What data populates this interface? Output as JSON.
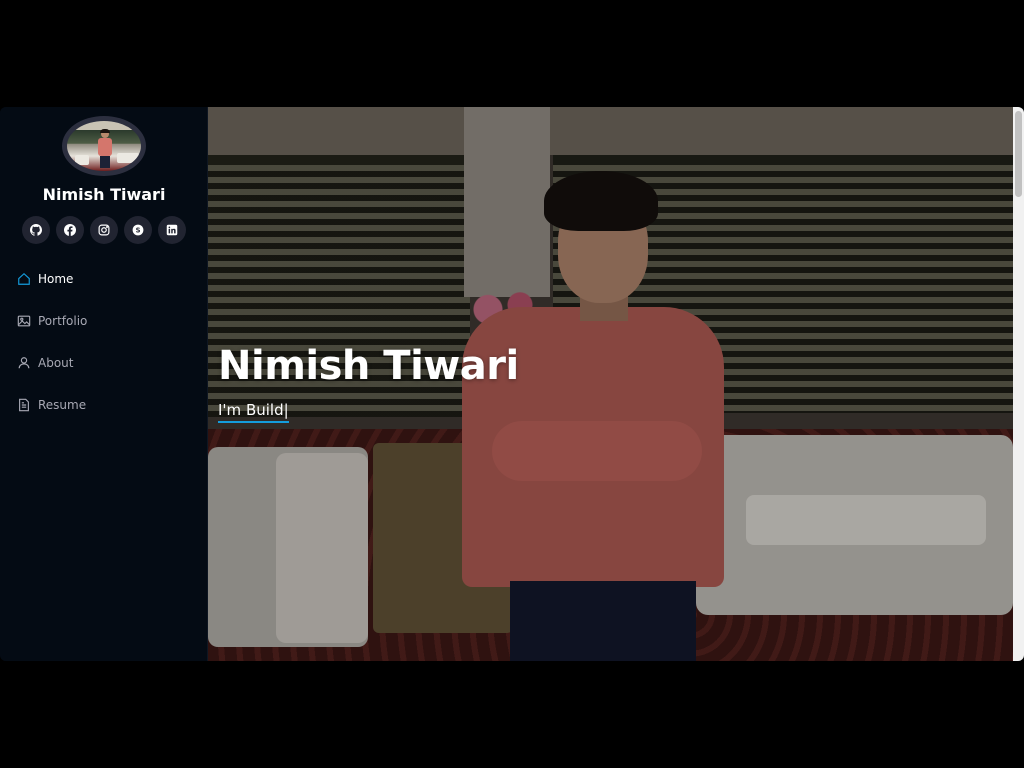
{
  "profile": {
    "name": "Nimish Tiwari"
  },
  "social": [
    {
      "name": "github-icon"
    },
    {
      "name": "facebook-icon"
    },
    {
      "name": "instagram-icon"
    },
    {
      "name": "skype-icon"
    },
    {
      "name": "linkedin-icon"
    }
  ],
  "nav": {
    "items": [
      {
        "label": "Home",
        "icon": "home-icon",
        "active": true
      },
      {
        "label": "Portfolio",
        "icon": "image-icon",
        "active": false
      },
      {
        "label": "About",
        "icon": "person-icon",
        "active": false
      },
      {
        "label": "Resume",
        "icon": "file-icon",
        "active": false
      }
    ]
  },
  "hero": {
    "title": "Nimish Tiwari",
    "subtitle_prefix": "I'm ",
    "typed_text": "Build",
    "cursor": "|"
  },
  "colors": {
    "sidebar_bg": "#040b14",
    "social_bg": "#212431",
    "accent": "#149ddd"
  }
}
